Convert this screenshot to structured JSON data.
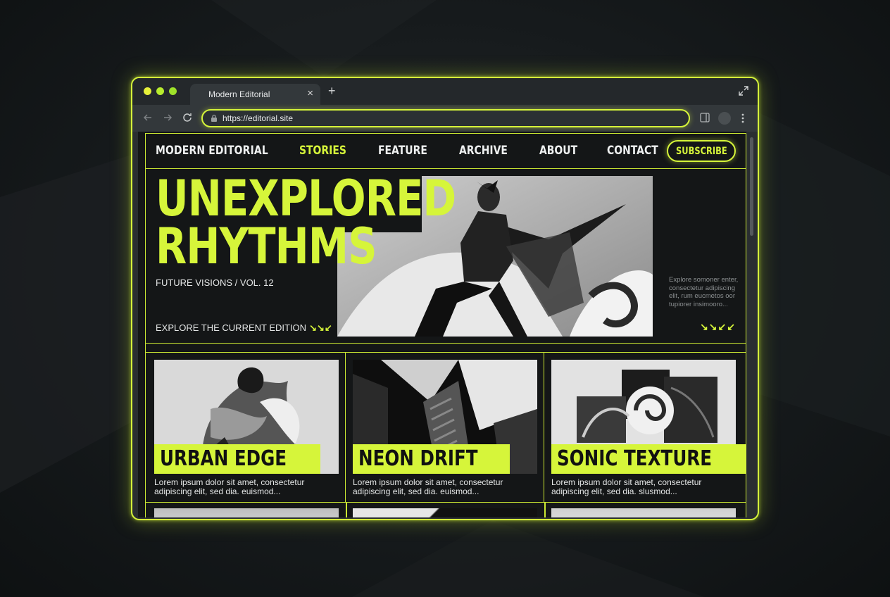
{
  "browser": {
    "tab_title": "Modern Editorial",
    "url": "https://editorial.site",
    "colors": {
      "accent": "#d6f53a",
      "chrome": "#33383b",
      "page_bg": "#141617"
    }
  },
  "site": {
    "logo": "MODERN EDITORIAL",
    "nav": [
      {
        "label": "STORIES",
        "active": true
      },
      {
        "label": "FEATURE",
        "active": false
      },
      {
        "label": "ARCHIVE",
        "active": false
      },
      {
        "label": "ABOUT",
        "active": false
      },
      {
        "label": "CONTACT",
        "active": false
      }
    ],
    "subscribe_label": "SUBSCRIBE",
    "hero": {
      "title_line1": "UNEXPLORED",
      "title_line2": "RHYTHMS",
      "subtitle": "FUTURE VISIONS / VOL. 12",
      "cta": "EXPLORE THE CURRENT EDITION",
      "cta_arrows": "↘↘↙",
      "side_text": "Explore somoner enter, consectetur adipiscing elit, rum eucmetos oor tupiorer insimooro...",
      "side_arrows": "↘↘↙↙"
    },
    "cards": [
      {
        "title": "URBAN EDGE",
        "excerpt": "Lorem ipsum dolor sit amet, consectetur adipiscing elit, sed dia. euismod..."
      },
      {
        "title": "NEON DRIFT",
        "excerpt": "Lorem ipsum dolor sit amet, consectetur adipiscing elit, sed dia. euismod..."
      },
      {
        "title": "SONIC TEXTURE",
        "excerpt": "Lorem ipsum dolor sit amet, consectetur adipiscing elit, sed dia. slusmod..."
      }
    ]
  }
}
